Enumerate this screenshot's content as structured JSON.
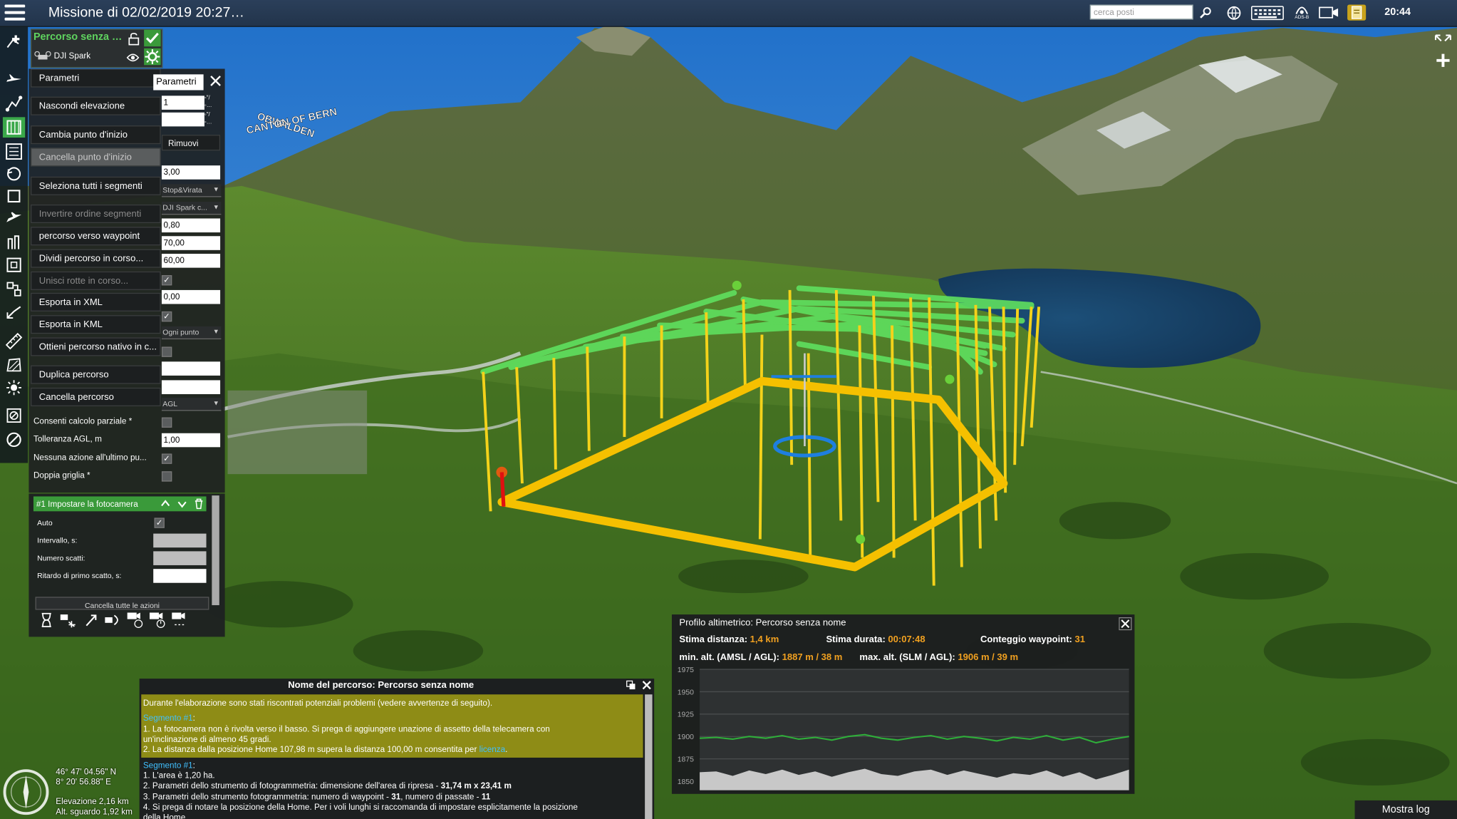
{
  "app": {
    "title": "Missione di 02/02/2019 20:27…",
    "search_placeholder": "cerca posti",
    "clock": "20:44",
    "adsb_label": "ADS-B"
  },
  "map": {
    "labels": [
      "OBWALDEN",
      "CANTON OF BERN"
    ]
  },
  "route": {
    "name": "Percorso senza …",
    "drone": "DJI Spark"
  },
  "menu": {
    "items": [
      {
        "label": "Parametri",
        "state": "normal"
      },
      {
        "label": "Nascondi elevazione",
        "state": "normal"
      },
      {
        "label": "Cambia punto d'inizio",
        "state": "normal"
      },
      {
        "label": "Cancella punto d'inizio",
        "state": "grey"
      },
      {
        "label": "Seleziona tutti i segmenti",
        "state": "normal"
      },
      {
        "label": "Invertire ordine segmenti",
        "state": "disabled"
      },
      {
        "label": "percorso verso waypoint",
        "state": "normal"
      },
      {
        "label": "Dividi percorso in corso...",
        "state": "normal"
      },
      {
        "label": "Unisci rotte in corso...",
        "state": "disabled"
      },
      {
        "label": "Esporta in XML",
        "state": "normal"
      },
      {
        "label": "Esporta in KML",
        "state": "normal"
      },
      {
        "label": "Ottieni percorso nativo in c...",
        "state": "normal"
      },
      {
        "label": "Duplica percorso",
        "state": "normal"
      },
      {
        "label": "Cancella percorso",
        "state": "normal"
      }
    ]
  },
  "params": {
    "tab_label": "Parametri",
    "remove_label": "Rimuovi",
    "field_1": "1",
    "field_2": "",
    "field_3": "3,00",
    "select_mode": "Stop&Virata",
    "select_camera": "DJI Spark c...",
    "field_4": "0,80",
    "field_5": "70,00",
    "field_6": "60,00",
    "field_7": "0,00",
    "select_action": "Ogni punto",
    "field_8": "",
    "field_9": "",
    "select_alt": "AGL",
    "partial_calc_label": "Consenti calcolo parziale *",
    "agl_tol_label": "Tolleranza AGL, m",
    "agl_tol_value": "1,00",
    "no_action_label": "Nessuna azione all'ultimo pu...",
    "double_grid_label": "Doppia griglia *"
  },
  "actions": {
    "header": "#1 Impostare la fotocamera",
    "auto_label": "Auto",
    "interval_label": "Intervallo, s:",
    "shots_label": "Numero scatti:",
    "delay_label": "Ritardo di primo scatto, s:",
    "delete_all": "Cancella tutte le azioni"
  },
  "warnings": {
    "title": "Nome del percorso: Percorso senza nome",
    "intro": "Durante l'elaborazione sono stati riscontrati potenziali problemi (vedere avvertenze di seguito).",
    "seg1_title": "Segmento #1",
    "seg1_line1": "1. La fotocamera non è rivolta verso il basso. Si prega di aggiungere unazione di assetto della telecamera con",
    "seg1_line1b": "un'inclinazione di almeno 45 gradi.",
    "seg1_line2": "2. La distanza dalla posizione Home 107,98 m supera la distanza 100,00 m consentita per ",
    "seg1_link": "licenza",
    "seg2_title": "Segmento #1",
    "seg2_line1": "1. L'area è 1,20 ha.",
    "seg2_line2": "2. Parametri dello strumento di fotogrammetria: dimensione dell'area di ripresa - ",
    "seg2_line2b": "31,74 m x 23,41 m",
    "seg2_line3": "3. Parametri dello strumento fotogrammetria: numero di waypoint - ",
    "seg2_line3b": "31",
    "seg2_line3c": ", numero di passate - ",
    "seg2_line3d": "11",
    "seg2_line4": "4. Si prega di notare la posizione della Home. Per i voli lunghi si raccomanda di impostare esplicitamente la posizione",
    "seg2_line4b": "della Home."
  },
  "profile": {
    "title": "Profilo altimetrico: Percorso senza nome",
    "dist_label": "Stima distanza: ",
    "dist_value": "1,4 km",
    "dur_label": "Stima durata: ",
    "dur_value": "00:07:48",
    "wp_label": "Conteggio waypoint: ",
    "wp_value": "31",
    "min_label": "min. alt. (AMSL / AGL): ",
    "min_value": "1887 m / 38 m",
    "max_label": "max. alt. (SLM / AGL): ",
    "max_value": "1906 m / 39 m",
    "colors": {
      "route_line": "#2fae3a",
      "terrain_fill": "#c8c8c8"
    }
  },
  "chart_data": {
    "type": "area",
    "title": "",
    "xlabel": "",
    "ylabel": "",
    "ylim": [
      1840,
      1975
    ],
    "yticks": [
      1850,
      1875,
      1900,
      1925,
      1950,
      1975
    ],
    "series": [
      {
        "values": [
          1898,
          1899,
          1897,
          1900,
          1898,
          1901,
          1897,
          1899,
          1896,
          1900,
          1902,
          1898,
          1896,
          1899,
          1901,
          1897,
          1900,
          1898,
          1895,
          1899,
          1897,
          1901,
          1896,
          1899,
          1893,
          1897,
          1900
        ]
      },
      {
        "values": [
          1860,
          1861,
          1856,
          1862,
          1858,
          1863,
          1857,
          1861,
          1855,
          1860,
          1864,
          1858,
          1856,
          1861,
          1863,
          1857,
          1862,
          1858,
          1854,
          1859,
          1857,
          1862,
          1855,
          1860,
          1852,
          1857,
          1863
        ]
      }
    ]
  },
  "status": {
    "lat": "46° 47' 04.56\" N",
    "lon": "8° 20' 56.88\" E",
    "elev": "Elevazione 2,16 km",
    "view_alt": "Alt. sguardo 1,92 km",
    "show_log": "Mostra log"
  }
}
